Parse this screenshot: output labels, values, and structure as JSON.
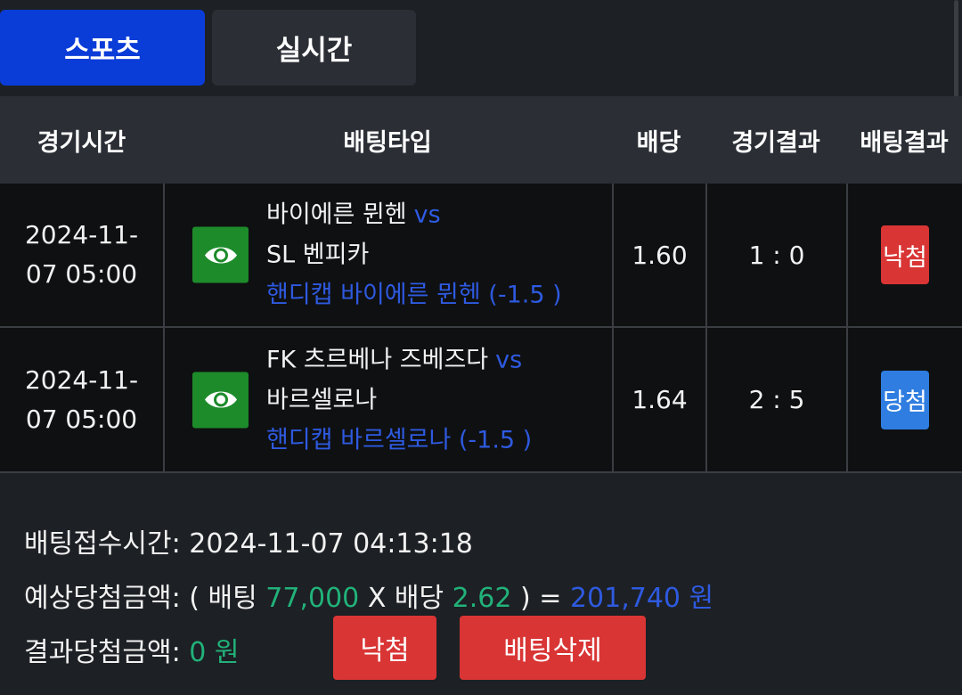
{
  "tabs": {
    "sports": "스포츠",
    "live": "실시간"
  },
  "table": {
    "headers": {
      "time": "경기시간",
      "type": "배팅타입",
      "odds": "배당",
      "result": "경기결과",
      "bet_result": "배팅결과"
    },
    "rows": [
      {
        "time_line1": "2024-11-",
        "time_line2": "07 05:00",
        "home": "바이에른 뮌헨",
        "vs": "vs",
        "away": "SL 벤피카",
        "pick": "핸디캡 바이에른 뮌헨 (-1.5 )",
        "odds": "1.60",
        "score": "1 : 0",
        "bet_result": "낙첨",
        "bet_result_color": "#d93535"
      },
      {
        "time_line1": "2024-11-",
        "time_line2": "07 05:00",
        "home": "FK 츠르베나 즈베즈다",
        "vs": "vs",
        "away": "바르셀로나",
        "pick": "핸디캡 바르셀로나 (-1.5 )",
        "odds": "1.64",
        "score": "2 : 5",
        "bet_result": "당첨",
        "bet_result_color": "#2f7de0"
      }
    ]
  },
  "summary": {
    "received_label": "배팅접수시간:",
    "received_value": "2024-11-07 04:13:18",
    "expected_label": "예상당첨금액:",
    "open_paren": "(",
    "bet_label": "배팅",
    "bet_amount": "77,000",
    "times": "X",
    "odds_label": "배당",
    "total_odds": "2.62",
    "close_paren_eq": ") =",
    "expected_amount": "201,740 원",
    "result_label": "결과당첨금액:",
    "result_amount": "0 원",
    "lose_button": "낙첨",
    "delete_button": "배팅삭제"
  },
  "colors": {
    "tab_active": "#0a3cd8",
    "tab_inactive": "#2b2f35",
    "accent_blue": "#2e5ae0",
    "accent_green": "#21b27a",
    "danger_red": "#d93535",
    "eye_green": "#1d8b2a"
  },
  "icons": {
    "view": "eye-icon"
  }
}
